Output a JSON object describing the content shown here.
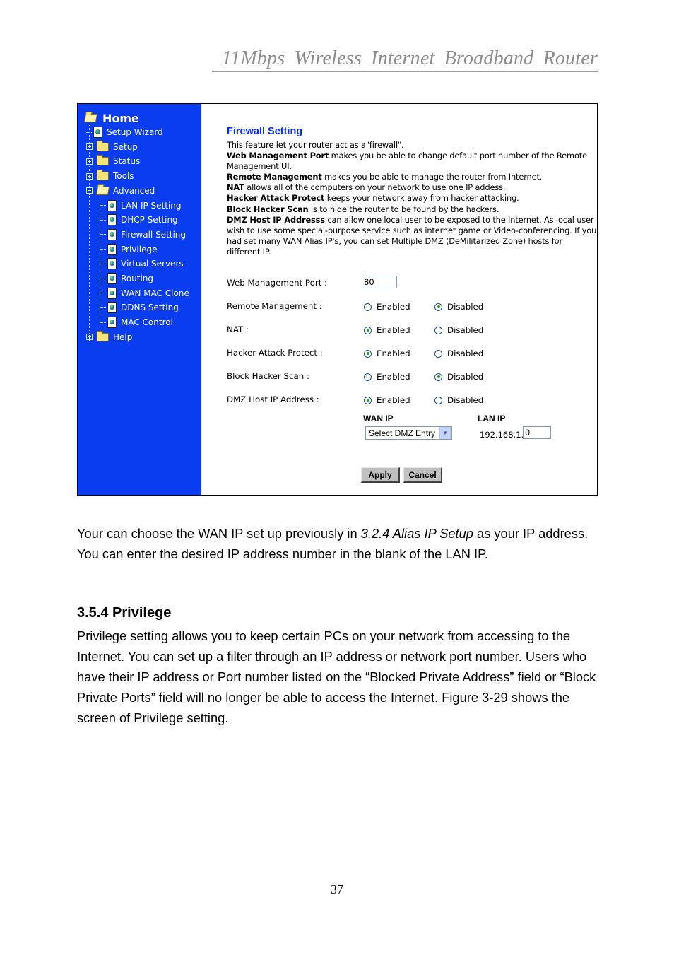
{
  "running_header": "11Mbps  Wireless  Internet  Broadband  Router",
  "sidebar": {
    "home": "Home",
    "items": [
      {
        "label": "Setup Wizard",
        "type": "page"
      },
      {
        "label": "Setup",
        "type": "folder"
      },
      {
        "label": "Status",
        "type": "folder"
      },
      {
        "label": "Tools",
        "type": "folder"
      },
      {
        "label": "Advanced",
        "type": "folder-open"
      },
      {
        "label": "LAN IP Setting",
        "type": "page"
      },
      {
        "label": "DHCP Setting",
        "type": "page"
      },
      {
        "label": "Firewall Setting",
        "type": "page"
      },
      {
        "label": "Privilege",
        "type": "page"
      },
      {
        "label": "Virtual Servers",
        "type": "page"
      },
      {
        "label": "Routing",
        "type": "page"
      },
      {
        "label": "WAN MAC Clone",
        "type": "page"
      },
      {
        "label": "DDNS Setting",
        "type": "page"
      },
      {
        "label": "MAC Control",
        "type": "page"
      },
      {
        "label": "Help",
        "type": "folder"
      }
    ]
  },
  "panel": {
    "title": "Firewall Setting",
    "intro": "This feature let your router act as a\"firewall\".",
    "descriptions": [
      {
        "term": "Web Management Port",
        "text": " makes you be able to change default port number of the Remote"
      },
      {
        "term": "",
        "text": "Management UI."
      },
      {
        "term": "Remote Management",
        "text": " makes you be able to manage the router from Internet."
      },
      {
        "term": "NAT",
        "text": " allows all of the computers on your network to use one IP addess."
      },
      {
        "term": "Hacker Attack Protect",
        "text": " keeps your network away from hacker attacking."
      },
      {
        "term": "Block Hacker Scan",
        "text": " is to hide the router to be found by the hackers."
      },
      {
        "term": "DMZ Host IP Addresss",
        "text": " can allow one local user to be exposed to the Internet. As local user"
      },
      {
        "term": "",
        "text": "wish to use some special-purpose service such as internet game or Video-conferencing.  If you"
      },
      {
        "term": "",
        "text": "had set many WAN Alias IP's, you can set Multiple DMZ (DeMilitarized Zone) hosts for"
      },
      {
        "term": "",
        "text": "different IP."
      }
    ],
    "web_port": {
      "label": "Web Management Port :",
      "value": "80"
    },
    "options": [
      {
        "label": "Remote Management :",
        "enabled_label": "Enabled",
        "disabled_label": "Disabled",
        "selected": "disabled"
      },
      {
        "label": "NAT :",
        "enabled_label": "Enabled",
        "disabled_label": "Disabled",
        "selected": "enabled"
      },
      {
        "label": "Hacker Attack Protect :",
        "enabled_label": "Enabled",
        "disabled_label": "Disabled",
        "selected": "enabled"
      },
      {
        "label": "Block Hacker Scan :",
        "enabled_label": "Enabled",
        "disabled_label": "Disabled",
        "selected": "disabled"
      },
      {
        "label": "DMZ Host IP Address :",
        "enabled_label": "Enabled",
        "disabled_label": "Disabled",
        "selected": "enabled"
      }
    ],
    "dmz": {
      "wan_ip_label": "WAN IP",
      "lan_ip_label": "LAN IP",
      "wan_select_value": "Select DMZ Entry",
      "lan_prefix": "192.168.1.",
      "lan_value": "0"
    },
    "apply_label": "Apply",
    "cancel_label": "Cancel"
  },
  "paragraph1": {
    "before": "Your can choose the WAN IP set up previously in ",
    "italic": "3.2.4 Alias IP Setup",
    "after": " as your IP address. You can enter the desired IP address number in the blank of the LAN IP."
  },
  "section": {
    "heading": "3.5.4 Privilege",
    "body": "Privilege setting allows you to keep certain PCs on your network from accessing to the Internet. You can set up a filter through an IP address or network port number. Users who have their IP address or Port number listed on the “Blocked Private Address” field or “Block Private Ports” field will no longer be able to access the Internet. Figure 3-29 shows the screen of Privilege setting."
  },
  "page_number": "37"
}
